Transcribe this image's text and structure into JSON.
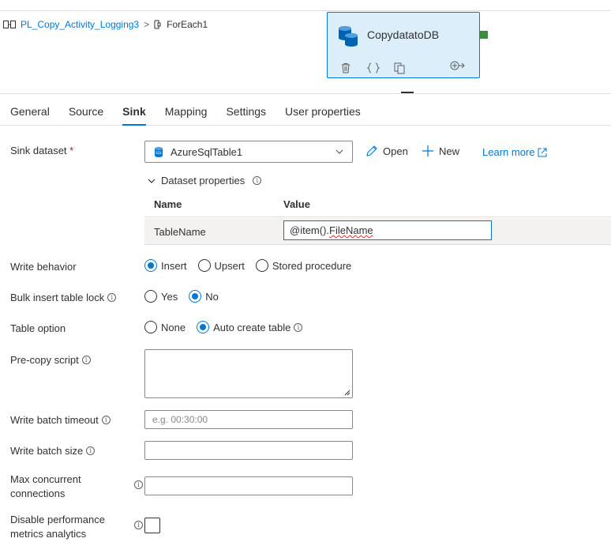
{
  "breadcrumb": {
    "pipeline": "PL_Copy_Activity_Logging3",
    "separator": ">",
    "current": "ForEach1"
  },
  "activity": {
    "name": "CopydatatoDB",
    "icon": "database-icon",
    "actions": [
      "delete-icon",
      "code-icon",
      "copy-icon",
      "go-to-icon"
    ]
  },
  "tabs": [
    {
      "label": "General"
    },
    {
      "label": "Source"
    },
    {
      "label": "Sink",
      "active": true
    },
    {
      "label": "Mapping"
    },
    {
      "label": "Settings"
    },
    {
      "label": "User properties"
    }
  ],
  "sink": {
    "dataset_label": "Sink dataset",
    "required_mark": "*",
    "dataset_value": "AzureSqlTable1",
    "open_label": "Open",
    "new_label": "New",
    "learn_more": "Learn more",
    "dataset_properties_label": "Dataset properties",
    "props_header_name": "Name",
    "props_header_value": "Value",
    "props_row_name": "TableName",
    "props_row_value_prefix": "@item().",
    "props_row_value_field": "FileName",
    "write_behavior_label": "Write behavior",
    "write_behavior_options": [
      "Insert",
      "Upsert",
      "Stored procedure"
    ],
    "write_behavior_selected": "Insert",
    "bulk_lock_label": "Bulk insert table lock",
    "bulk_lock_options": [
      "Yes",
      "No"
    ],
    "bulk_lock_selected": "No",
    "table_option_label": "Table option",
    "table_option_options": [
      "None",
      "Auto create table"
    ],
    "table_option_selected": "Auto create table",
    "precopy_label": "Pre-copy script",
    "batch_timeout_label": "Write batch timeout",
    "batch_timeout_placeholder": "e.g. 00:30:00",
    "batch_size_label": "Write batch size",
    "max_conn_label_1": "Max concurrent",
    "max_conn_label_2": "connections",
    "disable_perf_label_1": "Disable performance",
    "disable_perf_label_2": "metrics analytics"
  },
  "colors": {
    "accent": "#0078d4",
    "activity_bg": "#dceefa",
    "output_port": "#3b8e3b"
  }
}
